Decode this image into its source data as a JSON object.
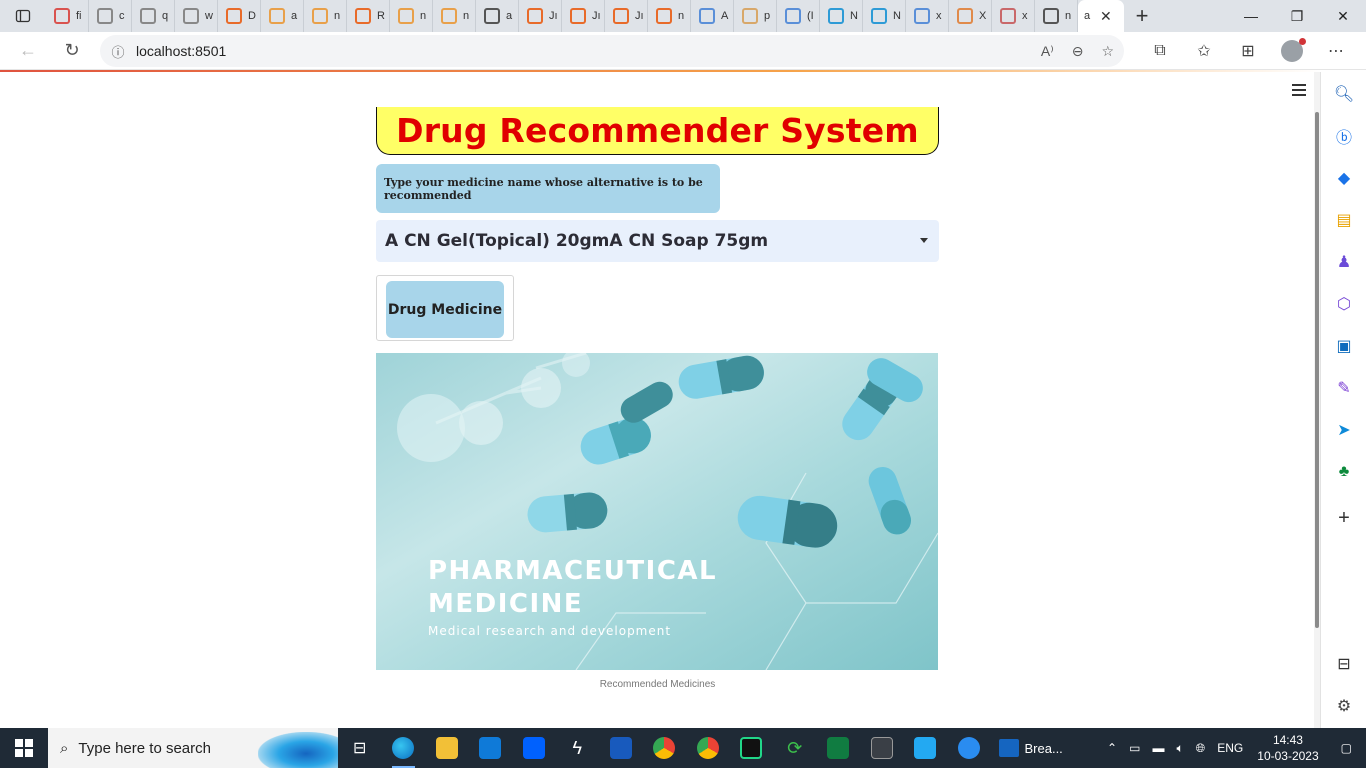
{
  "browser": {
    "url": "localhost:8501",
    "tabs": [
      "fi",
      "c",
      "q",
      "w",
      "D",
      "a",
      "n",
      "R",
      "n",
      "n",
      "a",
      "Jı",
      "Jı",
      "Jı",
      "n",
      "A",
      "p",
      "(I",
      "N",
      "N",
      "x",
      "X",
      "x",
      "n"
    ],
    "active_tab_label": "a"
  },
  "app": {
    "title": "Drug Recommender System",
    "hint": "Type your medicine name whose alternative is to be recommended",
    "select_value": "A CN Gel(Topical) 20gmA CN Soap 75gm",
    "button_label": "Drug Medicine",
    "banner_title_1": "PHARMACEUTICAL",
    "banner_title_2": "MEDICINE",
    "banner_subtitle": "Medical research and development",
    "caption": "Recommended Medicines"
  },
  "taskbar": {
    "search_placeholder": "Type here to search",
    "active_app_label": "Brea...",
    "language": "ENG",
    "time": "14:43",
    "date": "10-03-2023"
  },
  "colors": {
    "title_text": "#e00000",
    "title_bg": "#ffff66",
    "hint_bg": "#a8d5ea",
    "select_bg": "#e8f0fc",
    "button_bg": "#a8d5ea",
    "taskbar_bg": "#1f2a36"
  }
}
